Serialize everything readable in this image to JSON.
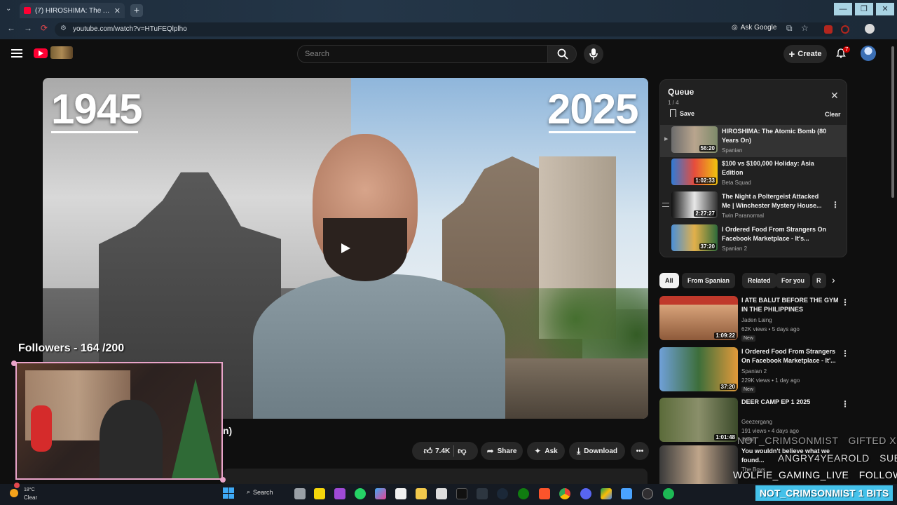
{
  "browser": {
    "tab_title": "(7) HIROSHIMA: The Atomic B...",
    "url": "youtube.com/watch?v=HTuFEQlplho",
    "ask_google": "Ask Google"
  },
  "youtube_header": {
    "search_placeholder": "Search",
    "create_label": "Create",
    "notification_count": "7"
  },
  "video": {
    "year_left": "1945",
    "year_right": "2025",
    "partial_title": "n)"
  },
  "actions": {
    "like_count": "7.4K",
    "share": "Share",
    "ask": "Ask",
    "download": "Download"
  },
  "queue": {
    "title": "Queue",
    "count": "1 / 4",
    "save": "Save",
    "clear": "Clear",
    "items": [
      {
        "title": "HIROSHIMA: The Atomic Bomb (80 Years On)",
        "channel": "Spanian",
        "duration": "56:20"
      },
      {
        "title": "$100 vs $100,000 Holiday: Asia Edition",
        "channel": "Beta Squad",
        "duration": "1:02:33"
      },
      {
        "title": "The Night a Poltergeist Attacked Me | Winchester Mystery House...",
        "channel": "Twin Paranormal",
        "duration": "2:27:27"
      },
      {
        "title": "I Ordered Food From Strangers On Facebook Marketplace - It's...",
        "channel": "Spanian 2",
        "duration": "37:20"
      }
    ]
  },
  "chips": [
    "All",
    "From Spanian",
    "Related",
    "For you",
    "R"
  ],
  "recommendations": [
    {
      "title": "I ATE BALUT BEFORE THE GYM IN THE PHILIPPINES",
      "channel": "Jaden Laing",
      "meta": "62K views • 5 days ago",
      "badge": "New",
      "duration": "1:09:22"
    },
    {
      "title": "I Ordered Food From Strangers On Facebook Marketplace - It'...",
      "channel": "Spanian 2",
      "meta": "229K views • 1 day ago",
      "badge": "New",
      "duration": "37:20"
    },
    {
      "title": "DEER CAMP EP 1 2025",
      "channel": "Geezergang",
      "meta": "191 views • 4 days ago",
      "badge": "New",
      "duration": "1:01:48"
    },
    {
      "title": "You wouldn't believe what we found...",
      "channel": "The Boys",
      "meta": "",
      "badge": "",
      "duration": ""
    }
  ],
  "stream_overlay": {
    "followers": "Followers - 164 /200",
    "alert1_name": "NOT_CRIMSONMIST",
    "alert1_action": "GIFTED X1",
    "alert2_name": "ANGRY4YEAROLD",
    "alert2_action": "SUB",
    "alert3_name": "WOLFIE_GAMING_LIVE",
    "alert3_action": "FOLLOW",
    "bits_banner": "NOT_CRIMSONMIST  1 BITS"
  },
  "taskbar": {
    "temperature": "18°C",
    "condition": "Clear",
    "search_label": "Search"
  },
  "colors": {
    "brand_red": "#ff0033",
    "background": "#0f0f0f",
    "panel": "#212121",
    "overlay_blue": "#44c1ea"
  }
}
